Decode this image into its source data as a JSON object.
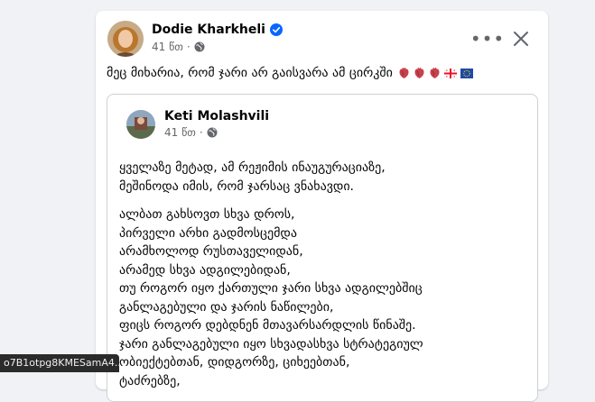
{
  "post": {
    "author": "Dodie Kharkheli",
    "time": "41 წთ",
    "separator": "·",
    "caption": "მეც მიხარია, რომ ჯარი არ გაისვარა ამ ცირკში",
    "more_label": "•••",
    "emoji": [
      "anatomical-heart",
      "anatomical-heart",
      "anatomical-heart",
      "georgia-flag",
      "eu-flag"
    ]
  },
  "shared": {
    "author": "Keti Molashvili",
    "time": "41 წთ",
    "separator": "·",
    "paragraphs": [
      [
        "ყველაზე მეტად, ამ რეჟიმის ინაუგურაციაზე,",
        "მეშინოდა იმის, რომ ჯარსაც ვნახავდი."
      ],
      [
        "ალბათ გახსოვთ სხვა დროს,",
        "პირველი არხი გადმოსცემდა",
        "არამხოლოდ რუსთაველიდან,",
        "არამედ სხვა ადგილებიდან,",
        "თუ როგორ იყო ქართული ჯარი სხვა ადგილებშიც",
        "განლაგებული და ჯარის ნაწილები,",
        "ფიცს როგორ დებდნენ მთავარსარდლის წინაშე.",
        "ჯარი განლაგებული იყო სხვადასხვა სტრატეგიულ",
        "ობიექტებთან, დიდგორზე, ციხეებთან,",
        "ტაძრებზე,"
      ]
    ]
  },
  "status_tooltip": "o7B1otpg8KMESamA4...",
  "colors": {
    "background": "#f0f2f5",
    "card": "#ffffff",
    "secondary_text": "#65676b",
    "verified_blue": "#0866ff"
  }
}
